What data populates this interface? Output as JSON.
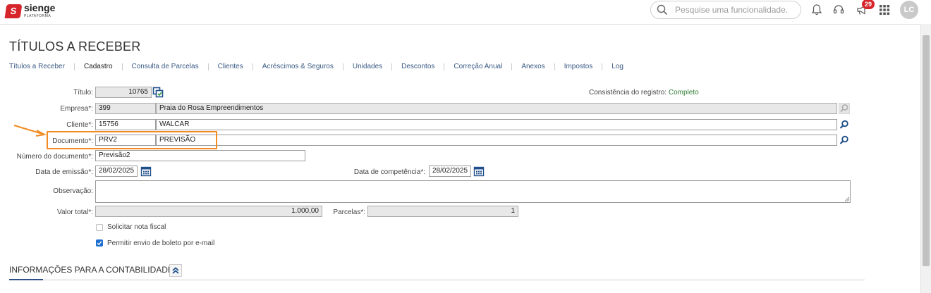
{
  "brand": {
    "name": "sienge",
    "sub": "PLATAFORMA",
    "mark": "S"
  },
  "header": {
    "search_placeholder": "Pesquise uma funcionalidade.",
    "notification_count": "29",
    "user_initials": "LC"
  },
  "page": {
    "title": "TÍTULOS A RECEBER"
  },
  "tabs": [
    {
      "label": "Títulos a Receber"
    },
    {
      "label": "Cadastro"
    },
    {
      "label": "Consulta de Parcelas"
    },
    {
      "label": "Clientes"
    },
    {
      "label": "Acréscimos & Seguros"
    },
    {
      "label": "Unidades"
    },
    {
      "label": "Descontos"
    },
    {
      "label": "Correção Anual"
    },
    {
      "label": "Anexos"
    },
    {
      "label": "Impostos"
    },
    {
      "label": "Log"
    }
  ],
  "form": {
    "titulo": {
      "label": "Título:",
      "value": "10765"
    },
    "consistencia": {
      "label": "Consistência do registro:",
      "value": "Completo"
    },
    "empresa": {
      "label": "Empresa*:",
      "code": "399",
      "name": "Praia do Rosa Empreendimentos"
    },
    "cliente": {
      "label": "Cliente*:",
      "code": "15756",
      "name": "WALCAR"
    },
    "documento": {
      "label": "Documento*:",
      "code": "PRV2",
      "name": "PREVISÃO"
    },
    "numero_documento": {
      "label": "Número do documento*:",
      "value": "Previsão2"
    },
    "data_emissao": {
      "label": "Data de emissão*:",
      "value": "28/02/2025"
    },
    "data_competencia": {
      "label": "Data de competência*:",
      "value": "28/02/2025"
    },
    "observacao": {
      "label": "Observação:",
      "value": ""
    },
    "valor_total": {
      "label": "Valor total*:",
      "value": "1.000,00"
    },
    "parcelas": {
      "label": "Parcelas*:",
      "value": "1"
    },
    "solicitar_nota": {
      "label": "Solicitar nota fiscal",
      "checked": false
    },
    "permitir_boleto": {
      "label": "Permitir envio de boleto por e-mail",
      "checked": true
    }
  },
  "section": {
    "title": "INFORMAÇÕES PARA A CONTABILIDADE"
  },
  "colors": {
    "accent": "#2b4f86",
    "brand": "#d6262b",
    "highlight": "#f28b22",
    "status_ok": "#2e7d32"
  }
}
